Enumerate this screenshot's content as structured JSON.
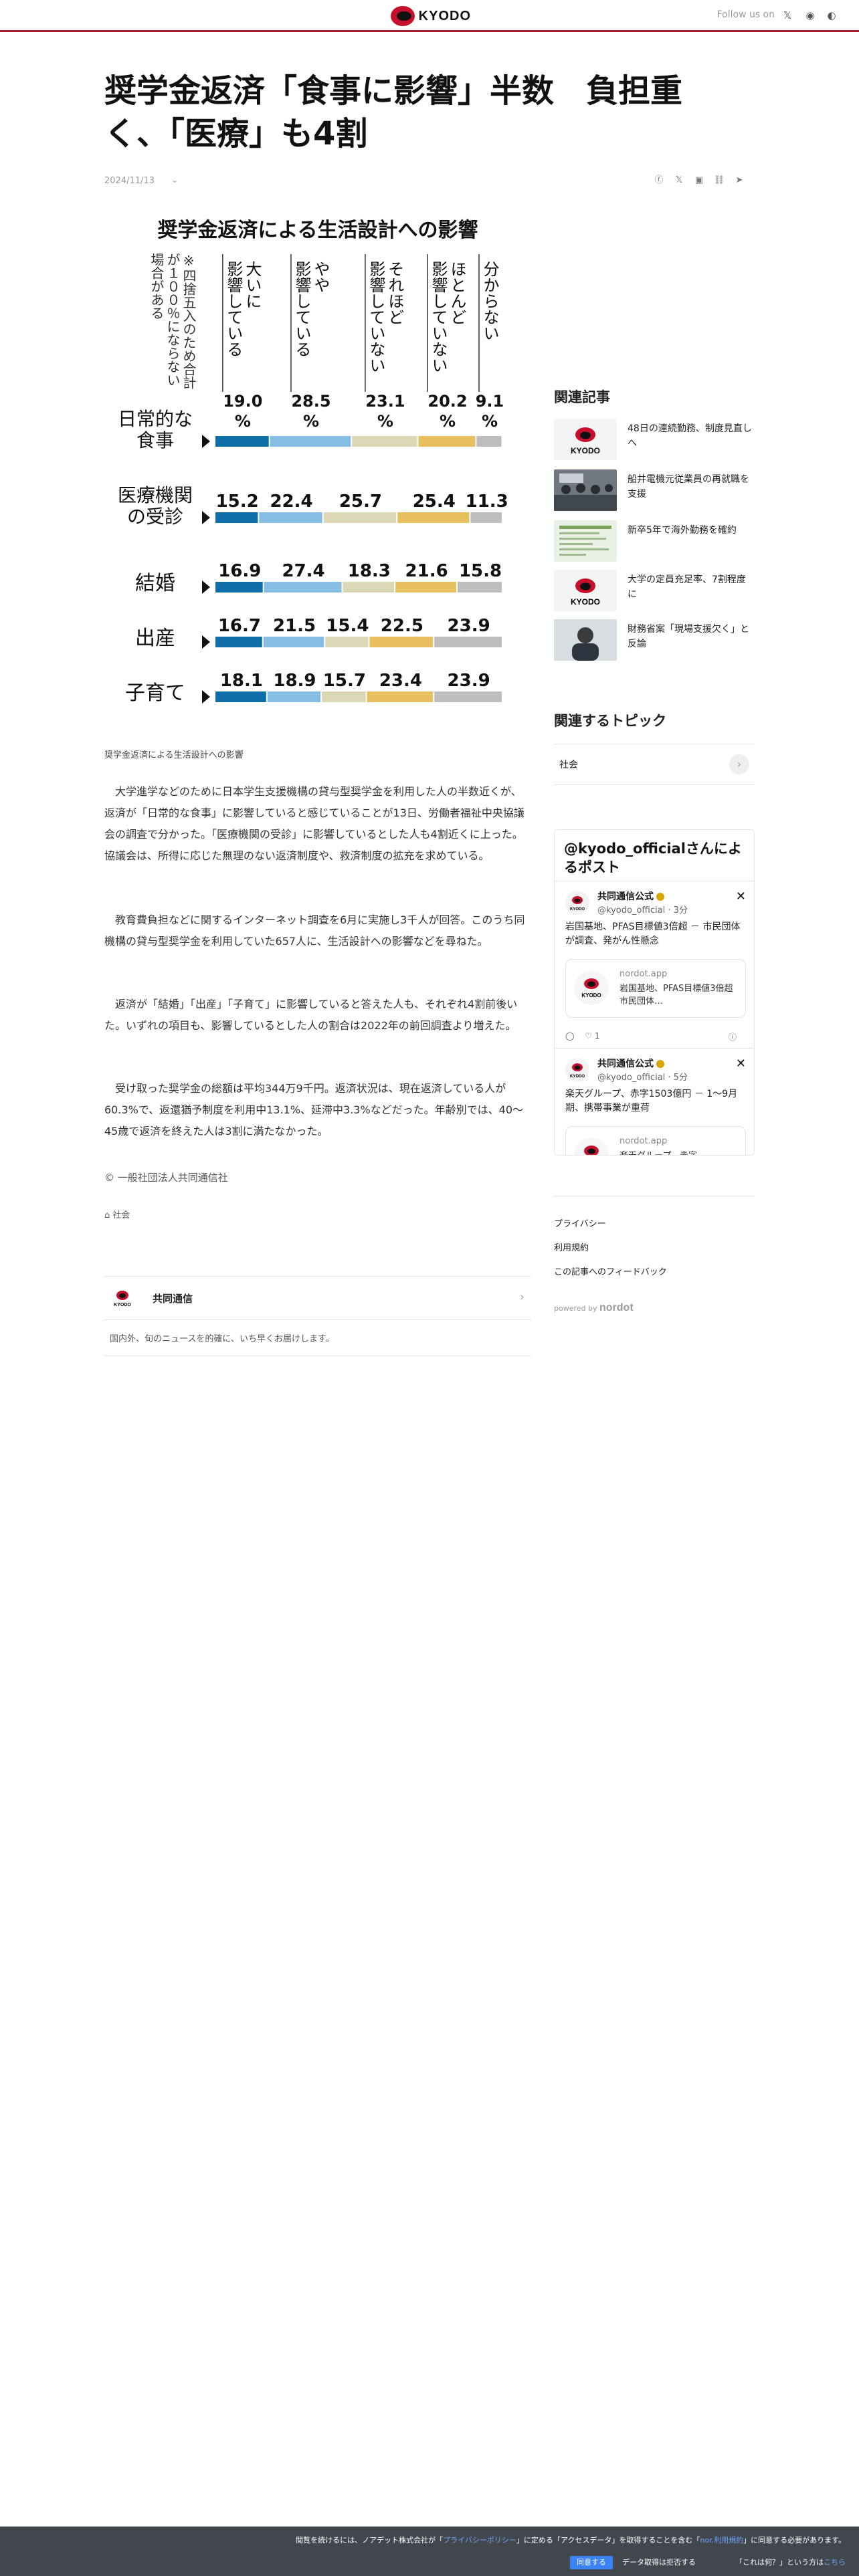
{
  "header": {
    "brand": "KYODO",
    "follow_label": "Follow us on"
  },
  "article": {
    "title": "奨学金返済「食事に影響」半数　負担重く、「医療」も4割",
    "date": "2024/11/13",
    "image_caption": "奨学金返済による生活設計への影響",
    "paragraphs": [
      "　大学進学などのために日本学生支援機構の貸与型奨学金を利用した人の半数近くが、返済が「日常的な食事」に影響していると感じていることが13日、労働者福祉中央協議会の調査で分かった。「医療機関の受診」に影響しているとした人も4割近くに上った。協議会は、所得に応じた無理のない返済制度や、救済制度の拡充を求めている。",
      "　教育費負担などに関するインターネット調査を6月に実施し3千人が回答。このうち同機構の貸与型奨学金を利用していた657人に、生活設計への影響などを尋ねた。",
      "　返済が「結婚」「出産」「子育て」に影響していると答えた人も、それぞれ4割前後いた。いずれの項目も、影響しているとした人の割合は2022年の前回調査より増えた。",
      "　受け取った奨学金の総額は平均344万9千円。返済状況は、現在返済している人が60.3%で、返還猶予制度を利用中13.1%、延滞中3.3%などだった。年齢別では、40～45歳で返済を終えた人は3割に満たなかった。"
    ],
    "copyright": "© 一般社団法人共同通信社",
    "tag": "社会",
    "publisher": {
      "name": "共同通信",
      "description": "国内外、旬のニュースを的確に、いち早くお届けします。"
    }
  },
  "chart_data": {
    "type": "bar",
    "title": "奨学金返済による生活設計への影響",
    "note": "※四捨五入のため合計が100％にならない場合がある",
    "orientation": "horizontal-stacked",
    "categories": [
      "日常的な食事",
      "医療機関の受診",
      "結婚",
      "出産",
      "子育て"
    ],
    "series": [
      {
        "name": "大いに影響している",
        "color": "#0e6fa8",
        "values": [
          19.0,
          15.2,
          16.9,
          16.7,
          18.1
        ]
      },
      {
        "name": "やや影響している",
        "color": "#86bde3",
        "values": [
          28.5,
          22.4,
          27.4,
          21.5,
          18.9
        ]
      },
      {
        "name": "それほど影響していない",
        "color": "#dcd7b4",
        "values": [
          23.1,
          25.7,
          18.3,
          15.4,
          15.7
        ]
      },
      {
        "name": "ほとんど影響していない",
        "color": "#e7c060",
        "values": [
          20.2,
          25.4,
          21.6,
          22.5,
          23.4
        ]
      },
      {
        "name": "分からない",
        "color": "#bdbdbd",
        "values": [
          9.1,
          11.3,
          15.8,
          23.9,
          23.9
        ]
      }
    ],
    "header_labels": [
      "19.0%",
      "28.5%",
      "23.1%",
      "20.2%",
      "9.1%"
    ],
    "category_lines": [
      [
        "日常的な",
        "食事"
      ],
      [
        "医療機関",
        "の受診"
      ],
      [
        "結婚"
      ],
      [
        "出産"
      ],
      [
        "子育て"
      ]
    ],
    "header_lines": [
      [
        "大いに",
        "影響している"
      ],
      [
        "やや",
        "影響している"
      ],
      [
        "それほど",
        "影響していない"
      ],
      [
        "ほとんど",
        "影響していない"
      ],
      [
        "分からない"
      ]
    ],
    "note_lines": [
      "※四捨五入のため合計",
      "が１００％にならない",
      "場合がある"
    ],
    "units_suffix": "%"
  },
  "sidebar": {
    "related_heading": "関連記事",
    "related": [
      {
        "title": "48日の連続勤務、制度見直しへ",
        "thumb": "kyodo-logo"
      },
      {
        "title": "船井電機元従業員の再就職を支援",
        "thumb": "photo-meeting"
      },
      {
        "title": "新卒5年で海外勤務を確約",
        "thumb": "photo-document"
      },
      {
        "title": "大学の定員充足率、7割程度に",
        "thumb": "kyodo-logo"
      },
      {
        "title": "財務省案「現場支援欠く」と反論",
        "thumb": "photo-portrait"
      }
    ],
    "topics_heading": "関連するトピック",
    "topic": "社会",
    "twitter": {
      "heading": "@kyodo_officialさんによるポスト",
      "tweets": [
        {
          "name": "共同通信公式",
          "handle": "@kyodo_official · 3分",
          "text": "岩国基地、PFAS目標値3倍超 － 市民団体が調査、発がん性懸念",
          "card_domain": "nordot.app",
          "card_title": "岩国基地、PFAS目標値3倍超　市民団体…",
          "likes": "1"
        },
        {
          "name": "共同通信公式",
          "handle": "@kyodo_official · 5分",
          "text": "楽天グループ、赤字1503億円 － 1〜9月期、携帯事業が重荷",
          "card_domain": "nordot.app",
          "card_title": "楽天グループ、赤字…"
        }
      ]
    },
    "links": [
      "プライバシー",
      "利用規約",
      "この記事へのフィードバック"
    ],
    "powered_by": "powered by",
    "powered_brand": "nordot"
  },
  "consent": {
    "text_before": "閲覧を続けるには、ノアデット株式会社が「",
    "policy_link": "プライバシーポリシー",
    "text_mid": "」に定める「アクセスデータ」を取得することを含む「",
    "terms_link": "nor.利用規約",
    "text_after": "」に同意する必要があります。",
    "agree": "同意する",
    "refuse": "データ取得は拒否する",
    "what_before": "「これは何？」という方は",
    "what_link": "こちら"
  },
  "colors": {
    "brand_red": "#c8102e",
    "accent_line": "#a8172a",
    "consent_bg": "#42474e",
    "agree_blue": "#3b82f6"
  }
}
